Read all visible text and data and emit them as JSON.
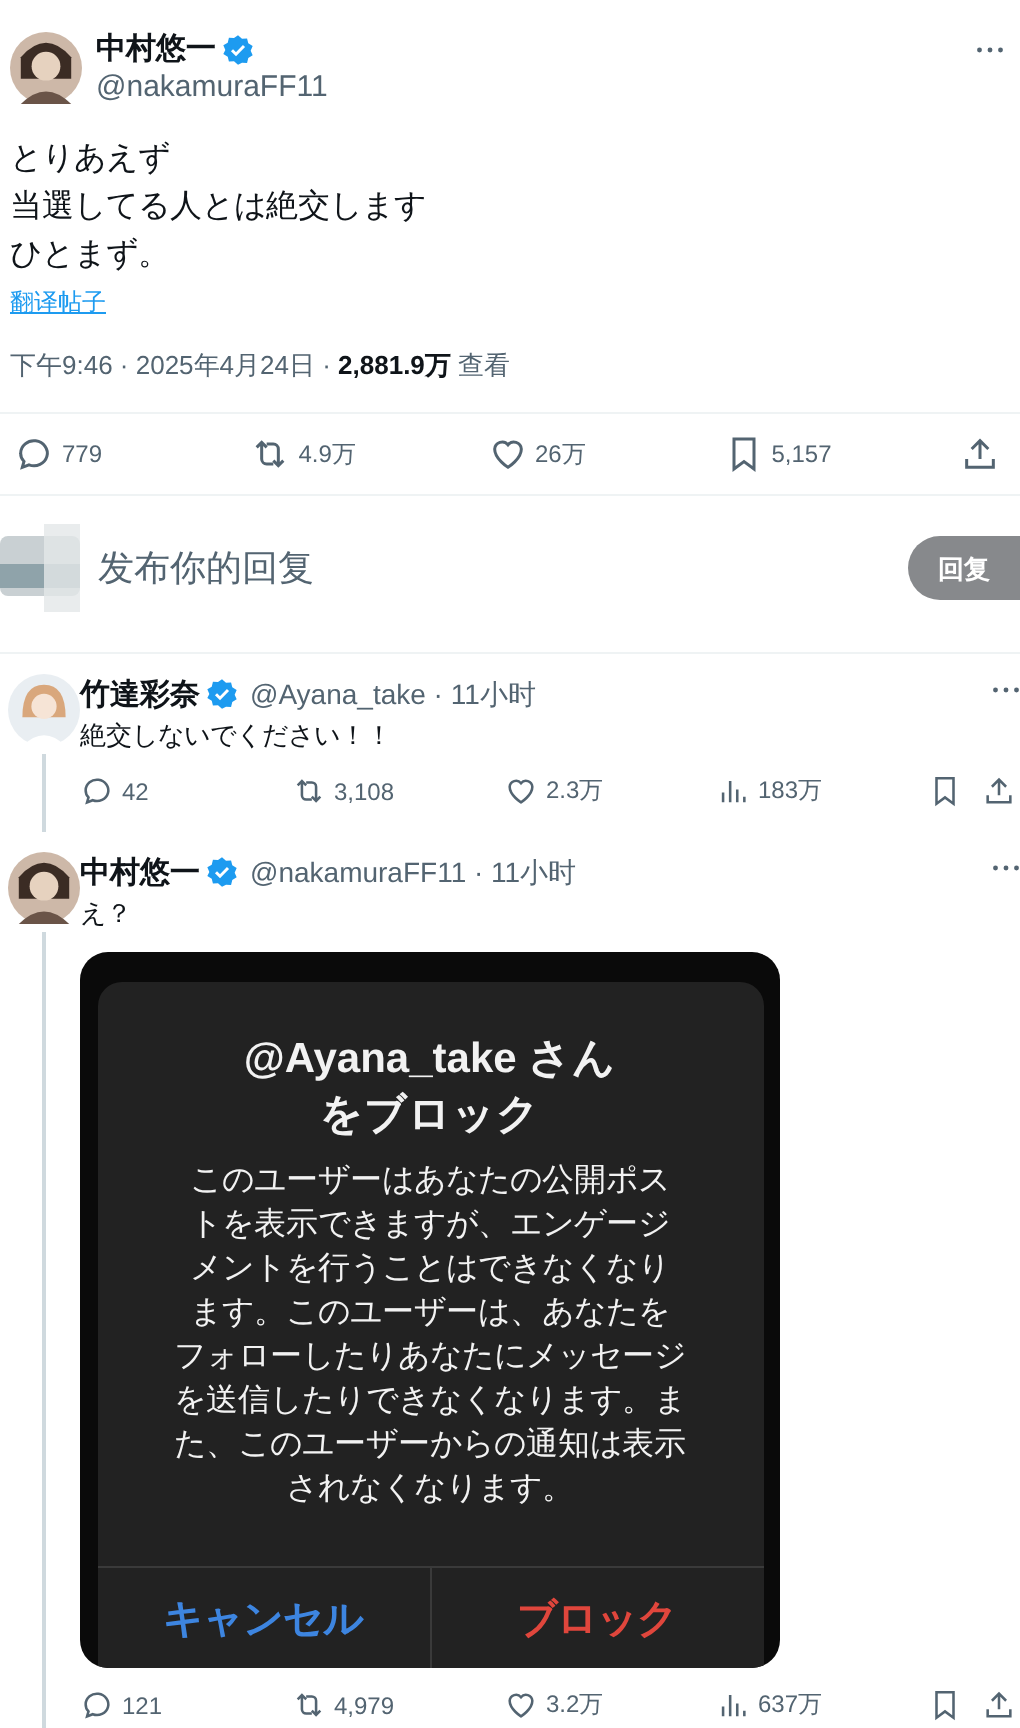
{
  "main_post": {
    "author": {
      "name": "中村悠一",
      "handle": "@nakamuraFF11",
      "verified": true
    },
    "text_lines": [
      "とりあえず",
      "当選してる人とは絶交します",
      "ひとまず。"
    ],
    "translate_link": "翻译帖子",
    "meta": "下午9:46 · 2025年4月24日 · **2,881.9万** 查看",
    "actions": [
      {
        "kind": "reply",
        "count": "779"
      },
      {
        "kind": "repost",
        "count": "4.9万"
      },
      {
        "kind": "like",
        "count": "26万"
      },
      {
        "kind": "bookmark",
        "count": "5,157"
      },
      {
        "kind": "share"
      }
    ]
  },
  "reply_composer": {
    "placeholder": "发布你的回复",
    "button": "回复"
  },
  "replies": [
    {
      "name": "竹達彩奈",
      "verified": true,
      "handle_time": "@Ayana_take · 11小时",
      "text": "絶交しないでください！！",
      "actions": [
        {
          "kind": "reply",
          "count": "42"
        },
        {
          "kind": "repost",
          "count": "3,108"
        },
        {
          "kind": "like",
          "count": "2.3万"
        },
        {
          "kind": "views",
          "count": "183万"
        },
        {
          "kind": "bookmark"
        },
        {
          "kind": "share"
        }
      ]
    },
    {
      "name": "中村悠一",
      "verified": true,
      "handle_time": "@nakamuraFF11 · 11小时",
      "text": "え？",
      "screenshot": {
        "title_lines": [
          "@Ayana_take さん",
          "をブロック"
        ],
        "body_lines": [
          "このユーザーはあなたの公開ポス",
          "トを表示できますが、エンゲージ",
          "メントを行うことはできなくなり",
          "ます。このユーザーは、あなたを",
          "フォローしたりあなたにメッセージ",
          "を送信したりできなくなります。ま",
          "た、このユーザーからの通知は表示",
          "されなくなります。"
        ],
        "buttons": [
          {
            "label": "キャンセル",
            "kind": "cancel"
          },
          {
            "label": "ブロック",
            "kind": "destructive"
          }
        ]
      },
      "actions": [
        {
          "kind": "reply",
          "count": "121"
        },
        {
          "kind": "repost",
          "count": "4,979"
        },
        {
          "kind": "like",
          "count": "3.2万"
        },
        {
          "kind": "views",
          "count": "637万"
        },
        {
          "kind": "bookmark"
        },
        {
          "kind": "share"
        }
      ]
    }
  ]
}
